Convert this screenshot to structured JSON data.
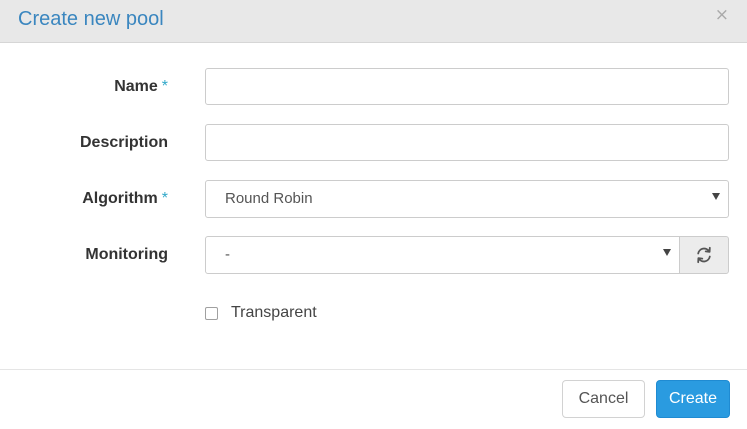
{
  "header": {
    "title": "Create new pool",
    "close_label": "×"
  },
  "form": {
    "name": {
      "label": "Name",
      "required_mark": "*",
      "value": ""
    },
    "description": {
      "label": "Description",
      "value": ""
    },
    "algorithm": {
      "label": "Algorithm",
      "required_mark": "*",
      "selected": "Round Robin"
    },
    "monitoring": {
      "label": "Monitoring",
      "selected": "-",
      "refresh_icon": "refresh-icon"
    },
    "transparent": {
      "label": "Transparent",
      "checked": false
    }
  },
  "footer": {
    "cancel_label": "Cancel",
    "create_label": "Create"
  },
  "colors": {
    "title": "#3a86bf",
    "required": "#31a8c9",
    "primary_button": "#2a9be0"
  }
}
